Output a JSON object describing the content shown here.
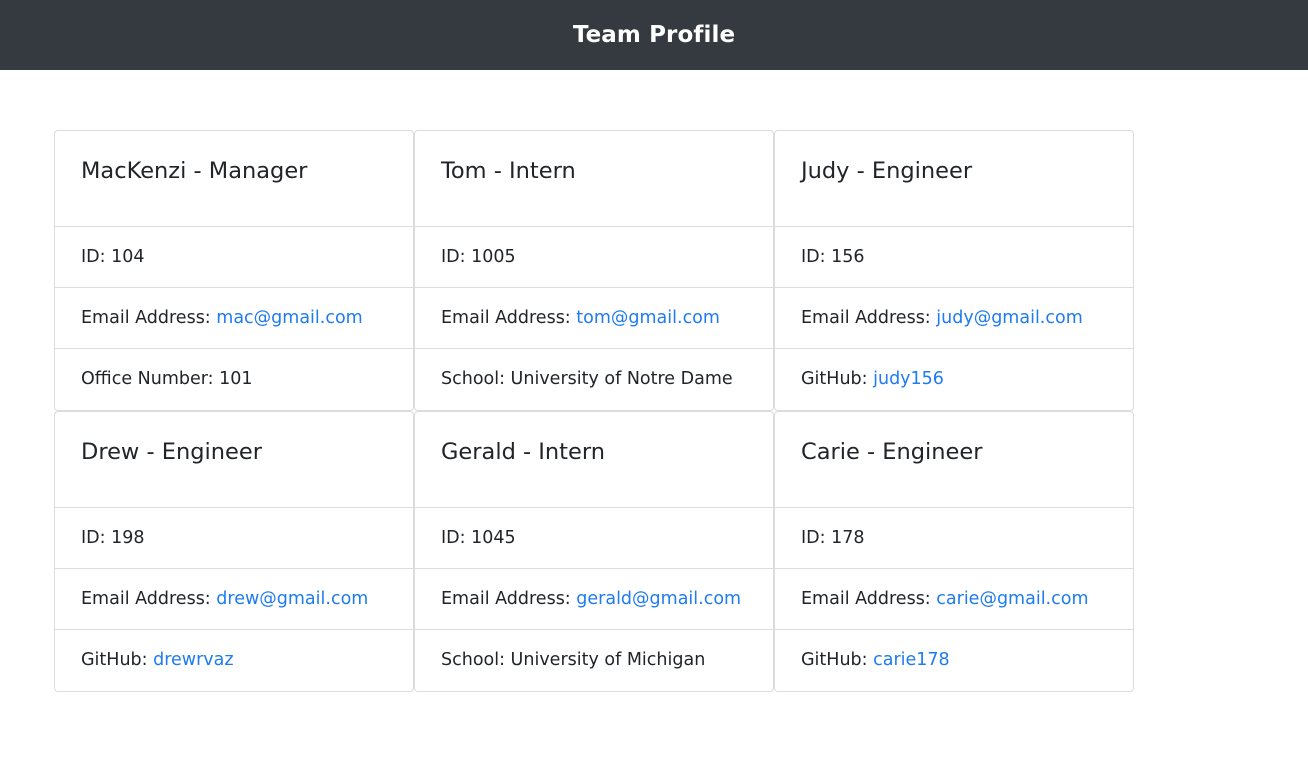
{
  "header": {
    "title": "Team Profile"
  },
  "colors": {
    "navbar": "#343a40",
    "link": "#1e7bf0",
    "border": "#dcdcdc"
  },
  "cards": [
    {
      "title": "MacKenzi - Manager",
      "id_text": "ID: 104",
      "email_label": "Email Address: ",
      "email": "mac@gmail.com",
      "extra_label": "Office Number: 101",
      "extra_link": ""
    },
    {
      "title": "Tom - Intern",
      "id_text": "ID: 1005",
      "email_label": "Email Address: ",
      "email": "tom@gmail.com",
      "extra_label": "School: University of Notre Dame",
      "extra_link": ""
    },
    {
      "title": "Judy - Engineer",
      "id_text": "ID: 156",
      "email_label": "Email Address: ",
      "email": "judy@gmail.com",
      "extra_label": "GitHub: ",
      "extra_link": "judy156"
    },
    {
      "title": "Drew - Engineer",
      "id_text": "ID: 198",
      "email_label": "Email Address: ",
      "email": "drew@gmail.com",
      "extra_label": "GitHub: ",
      "extra_link": "drewrvaz"
    },
    {
      "title": "Gerald - Intern",
      "id_text": "ID: 1045",
      "email_label": "Email Address: ",
      "email": "gerald@gmail.com",
      "extra_label": "School: University of Michigan",
      "extra_link": ""
    },
    {
      "title": "Carie - Engineer",
      "id_text": "ID: 178",
      "email_label": "Email Address: ",
      "email": "carie@gmail.com",
      "extra_label": "GitHub: ",
      "extra_link": "carie178"
    }
  ]
}
